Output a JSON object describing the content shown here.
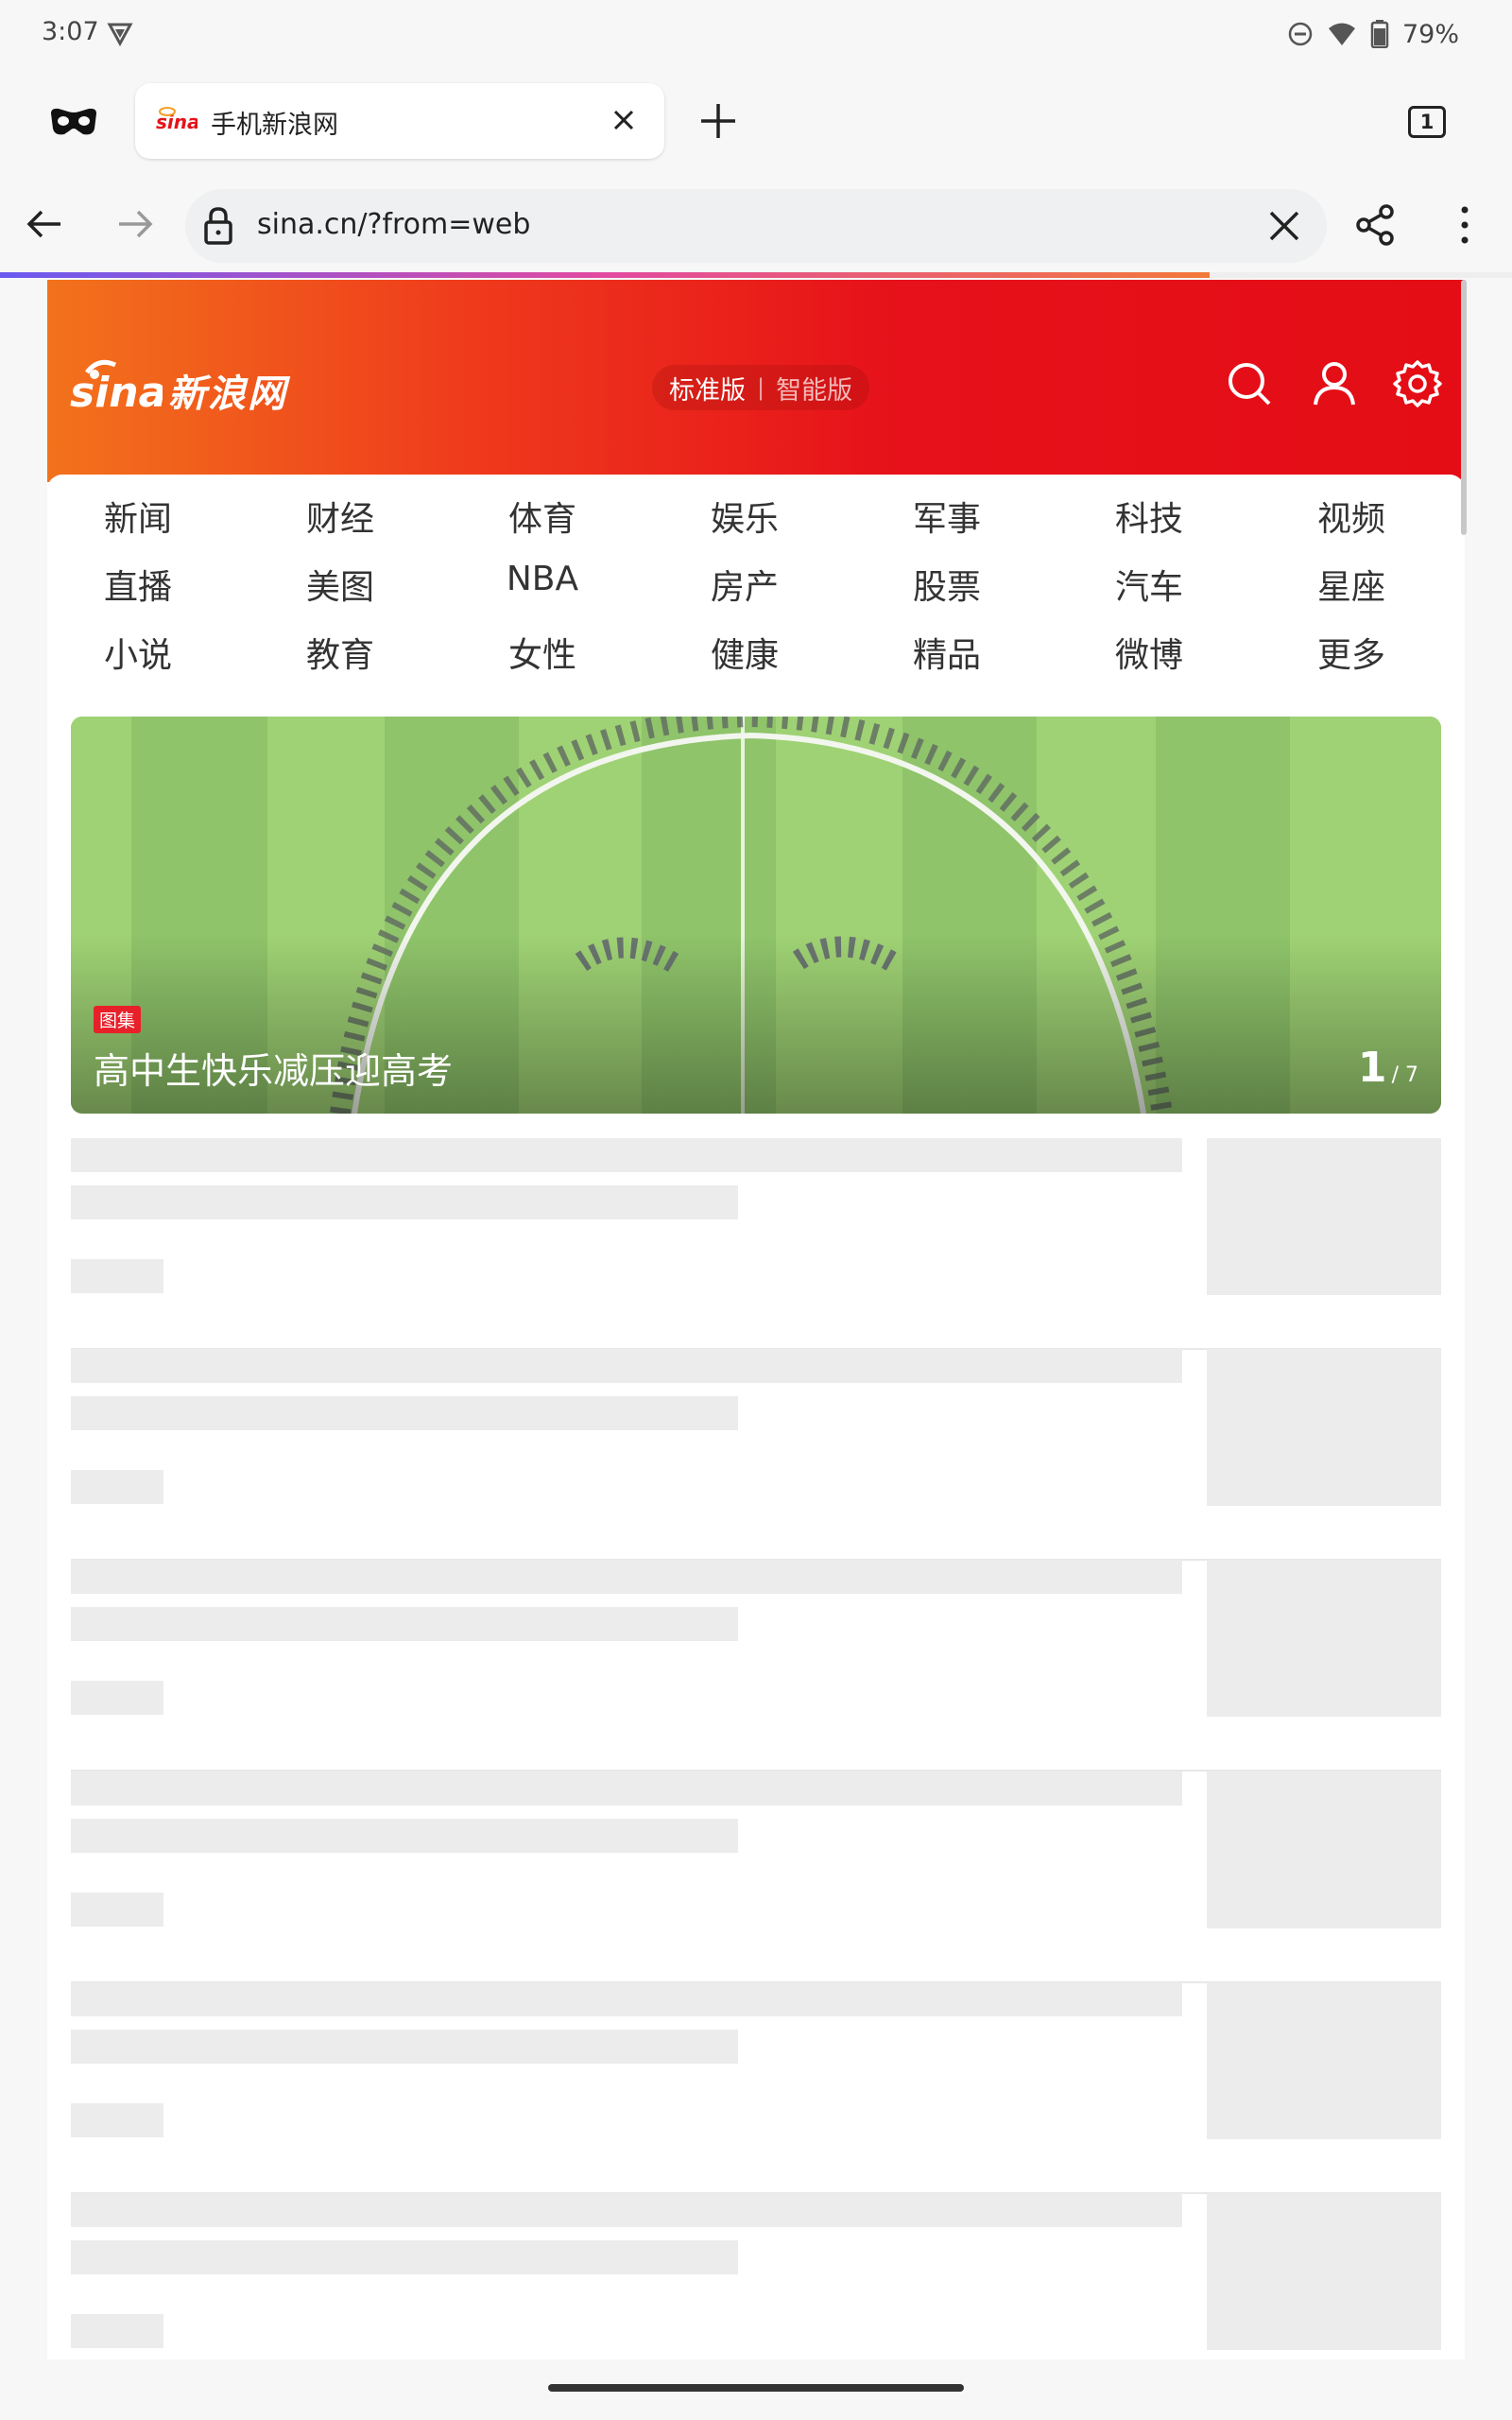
{
  "status_bar": {
    "time": "3:07",
    "battery": "79%",
    "icons": [
      "vpn-icon",
      "do-not-disturb-icon",
      "wifi-icon",
      "battery-icon"
    ]
  },
  "tabs": {
    "active_title": "手机新浪网",
    "count": "1"
  },
  "address_bar": {
    "url": "sina.cn/?from=web",
    "progress": 0.8
  },
  "site_header": {
    "logo_text": "新浪网",
    "mode_standard": "标准版",
    "mode_separator": "|",
    "mode_smart": "智能版",
    "colors": {
      "start": "#f2721c",
      "end": "#e40d16"
    }
  },
  "nav": {
    "rows": [
      [
        "新闻",
        "财经",
        "体育",
        "娱乐",
        "军事",
        "科技",
        "视频"
      ],
      [
        "直播",
        "美图",
        "NBA",
        "房产",
        "股票",
        "汽车",
        "星座"
      ],
      [
        "小说",
        "教育",
        "女性",
        "健康",
        "精品",
        "微博",
        "更多"
      ]
    ]
  },
  "banner": {
    "tag": "图集",
    "title": "高中生快乐减压迎高考",
    "current": "1",
    "total": "/ 7"
  }
}
